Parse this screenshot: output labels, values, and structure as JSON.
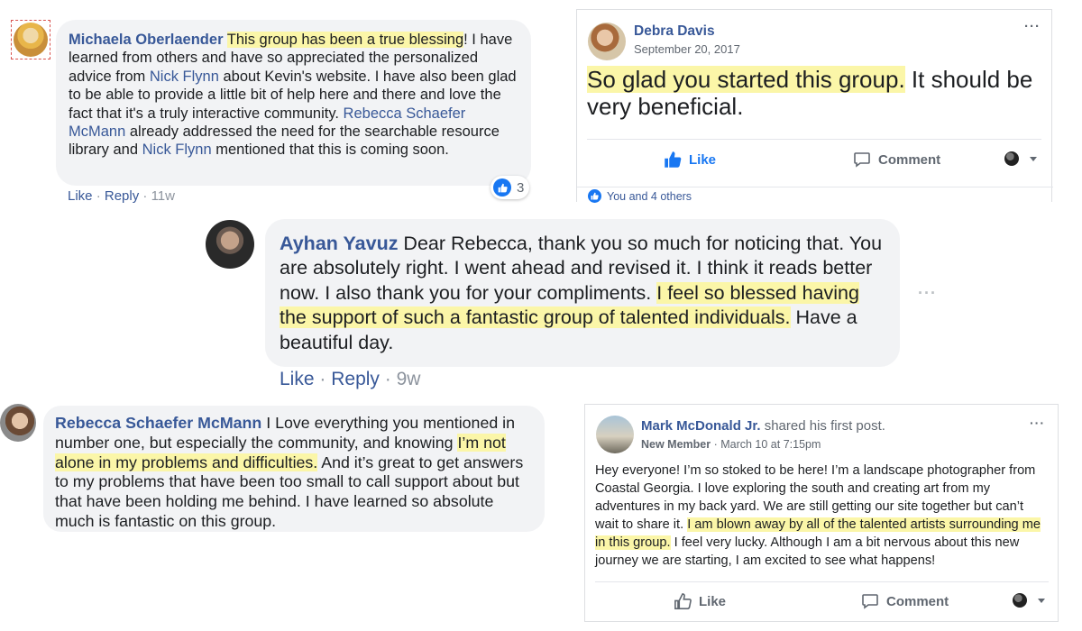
{
  "comment1": {
    "author": "Michaela Oberlaender",
    "hl1": "This group has been a true blessing",
    "t1": "! I have learned from others and have so appreciated the personalized advice from ",
    "link1": "Nick Flynn",
    "t2": " about Kevin's website. I have also been glad to be able to provide a little bit of help here and there and love the fact that it's a truly interactive community. ",
    "link2": "Rebecca Schaefer McMann",
    "t3": " already addressed the need for the searchable resource library and ",
    "link3": "Nick Flynn",
    "t4": " mentioned that this is coming soon.",
    "like": "Like",
    "reply": "Reply",
    "sep": "·",
    "time": "11w",
    "reaction_count": "3"
  },
  "post1": {
    "author": "Debra Davis",
    "date": "September 20, 2017",
    "hl": "So glad you started this group.",
    "rest": " It should be very beneficial.",
    "like": "Like",
    "comment": "Comment",
    "reactions": "You and 4 others",
    "more": "···"
  },
  "comment2": {
    "author": "Ayhan Yavuz",
    "t1": " Dear Rebecca, thank you so much for noticing that. You are absolutely right. I went ahead and revised it. I think it reads better now. I also thank you for your compliments. ",
    "hl": "I feel so blessed having the support of such a fantastic group of talented individuals.",
    "t2": " Have a beautiful day.",
    "like": "Like",
    "reply": "Reply",
    "sep": "·",
    "time": "9w",
    "more": "···"
  },
  "comment3": {
    "author": "Rebecca Schaefer McMann",
    "t1": " I Love everything you mentioned in number one, but especially the community, and knowing ",
    "hl": "I’m not alone in my problems and difficulties.",
    "t2": " And it’s great to get answers to my problems that have been too small to call support about but that have been holding me behind. I have learned so absolute much is fantastic on this group."
  },
  "post2": {
    "author": "Mark McDonald Jr.",
    "action": " shared his first post.",
    "badge": "New Member",
    "sep": " · ",
    "date": "March 10 at 7:15pm",
    "t1": "Hey everyone! I’m so stoked to be here! I’m a landscape photographer from Coastal Georgia. I love exploring the south and creating art from my adventures in my back yard. We are still getting our site together but can’t wait to share it. ",
    "hl": "I am blown away by all of the talented artists surrounding me in this group.",
    "t2": " I feel very lucky. Although I am a bit nervous about this new journey we are starting, I am excited to see what happens!",
    "like": "Like",
    "comment": "Comment",
    "more": "···"
  },
  "colors": {
    "link": "#385898",
    "bubble": "#f2f3f5",
    "highlight": "#fbf6a8",
    "like_blue": "#1877f2"
  }
}
